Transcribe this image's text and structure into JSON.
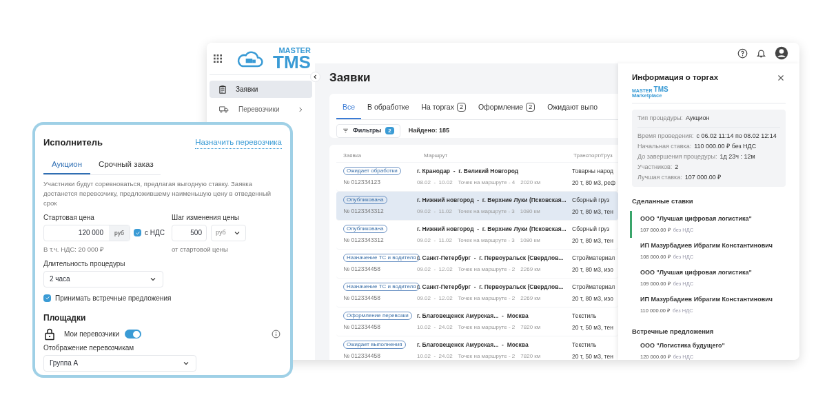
{
  "app": {
    "logo": {
      "top": "MASTER",
      "bottom": "TMS"
    },
    "nav": [
      {
        "label": "Заявки",
        "selected": true,
        "has_submenu": false
      },
      {
        "label": "Перевозчики",
        "selected": false,
        "has_submenu": true
      }
    ],
    "page_title": "Заявки",
    "tabs": [
      {
        "label": "Все",
        "selected": true
      },
      {
        "label": "В обработке",
        "selected": false
      },
      {
        "label": "На торгах",
        "count": "2",
        "selected": false
      },
      {
        "label": "Оформление",
        "count": "2",
        "selected": false
      },
      {
        "label": "Ожидают выпо",
        "selected": false
      }
    ],
    "filters": {
      "label": "Фильтры",
      "count": "2"
    },
    "found": "Найдено: 185",
    "table": {
      "columns": [
        "Заявка",
        "Маршрут",
        "Транспорт/Груз"
      ],
      "rows": [
        {
          "status": "Ожидает обработки",
          "number": "№ 012334123",
          "route": "г. Кранодар  -  г. Великий Новгород",
          "dates": "08.02  -  10.02",
          "points": "Точек на маршруте - 4",
          "distance": "2020 км",
          "cargo": "Товарны народ",
          "specs": "20 т, 80 м3, реф",
          "selected": false
        },
        {
          "status": "Опубликована",
          "number": "№ 0123343312",
          "route": "г. Нижний новгород  -  г. Верхние Луки (Псковская...",
          "dates": "09.02  -  11.02",
          "points": "Точек на маршруте - 3",
          "distance": "1080 км",
          "cargo": "Сборный груз",
          "specs": "20 т, 80 м3, тен",
          "selected": true
        },
        {
          "status": "Опубликована",
          "number": "№ 0123343312",
          "route": "г. Нижний новгород  -  г. Верхние Луки (Псковская...",
          "dates": "09.02  -  11.02",
          "points": "Точек на маршруте - 3",
          "distance": "1080 км",
          "cargo": "Сборный груз",
          "specs": "20 т, 80 м3, тен",
          "selected": false
        },
        {
          "status": "Назначение ТС и водителя",
          "number": "№ 012334458",
          "route": "г. Санкт-Петербург  -  г. Первоуральск (Свердлов...",
          "dates": "09.02  -  12.02",
          "points": "Точек на маршруте - 2",
          "distance": "2269 км",
          "cargo": "Стройматериал",
          "specs": "20 т, 80 м3, изо",
          "selected": false
        },
        {
          "status": "Назначение ТС и водителя",
          "number": "№ 012334458",
          "route": "г. Санкт-Петербург  -  г. Первоуральск (Свердлов...",
          "dates": "09.02  -  12.02",
          "points": "Точек на маршруте - 2",
          "distance": "2269 км",
          "cargo": "Стройматериал",
          "specs": "20 т, 80 м3, изо",
          "selected": false
        },
        {
          "status": "Оформление перевозки",
          "number": "№ 012334458",
          "route": "г. Благовещенск Амурская...  -  Москва",
          "dates": "10.02  -  24.02",
          "points": "Точек на маршруте - 2",
          "distance": "7820 км",
          "cargo": "Текстиль",
          "specs": "20 т, 50 м3, тен",
          "selected": false
        },
        {
          "status": "Ожидает выполнения",
          "number": "№ 012334458",
          "route": "г. Благовещенск Амурская...  -  Москва",
          "dates": "10.02  -  24.02",
          "points": "Точек на маршруте - 2",
          "distance": "7820 км",
          "cargo": "Текстиль",
          "specs": "20 т, 50 м3, тен",
          "selected": false
        }
      ]
    },
    "panel": {
      "title": "Информация о торгах",
      "logo": {
        "top": "MASTER",
        "middle": "TMS",
        "bottom": "Marketplace"
      },
      "procedure": {
        "label": "Тип процедуры:",
        "value": "Аукцион"
      },
      "details": [
        {
          "label": "Время проведения:",
          "value": "с 06.02 11:14 по 08.02 12:14"
        },
        {
          "label": "Начальная ставка:",
          "value": "110 000.00 ₽ без НДС"
        },
        {
          "label": "До завершения процедуры:",
          "value": "1д 23ч : 12м"
        },
        {
          "label": "Участников:",
          "value": "2"
        },
        {
          "label": "Лучшая ставка:",
          "value": "107 000.00 ₽"
        }
      ],
      "bids_title": "Сделанные ставки",
      "bids": [
        {
          "name": "ООО \"Лучшая цифровая логистика\"",
          "price": "107 000.00 ₽",
          "vat": "без НДС",
          "selected": true
        },
        {
          "name": "ИП Мазурбадиев Ибрагим Константинович",
          "price": "108 000.00 ₽",
          "vat": "без НДС",
          "selected": false
        },
        {
          "name": "ООО \"Лучшая цифровая логистика\"",
          "price": "109 000.00 ₽",
          "vat": "без НДС",
          "selected": false
        },
        {
          "name": "ИП Мазурбадиев Ибрагим Константинович",
          "price": "110 000.00 ₽",
          "vat": "без НДС",
          "selected": false
        }
      ],
      "counter_title": "Встречные предложения",
      "counter_offers": [
        {
          "name": "ООО \"Логистика будущего\"",
          "price": "120 000.00 ₽",
          "vat": "без НДС"
        }
      ]
    }
  },
  "card": {
    "title": "Исполнитель",
    "assign_link": "Назначить перевозчика",
    "tabs": [
      {
        "label": "Аукцион",
        "selected": true
      },
      {
        "label": "Срочный заказ",
        "selected": false
      }
    ],
    "description": "Участники будут соревноваться, предлагая выгодную ставку. Заявка достанется перевозчику, предложившему наименьшую цену в отведенный срок",
    "start_price": {
      "label": "Стартовая цена",
      "value": "120 000",
      "unit": "руб"
    },
    "vat": {
      "label": "с НДС",
      "checked": true
    },
    "vat_note": "В т.ч. НДС: 20 000 ₽",
    "step": {
      "label": "Шаг изменения цены",
      "value": "500",
      "unit": "руб",
      "note": "от стартовой цены"
    },
    "duration": {
      "label": "Длительность процедуры",
      "value": "2 часа"
    },
    "accept_counter": {
      "label": "Принимать встречные предложения",
      "checked": true
    },
    "platforms_title": "Площадки",
    "my_carriers": {
      "label": "Мои перевозчики",
      "on": true
    },
    "display": {
      "label": "Отображение перевозчикам",
      "value": "Группа А"
    }
  }
}
